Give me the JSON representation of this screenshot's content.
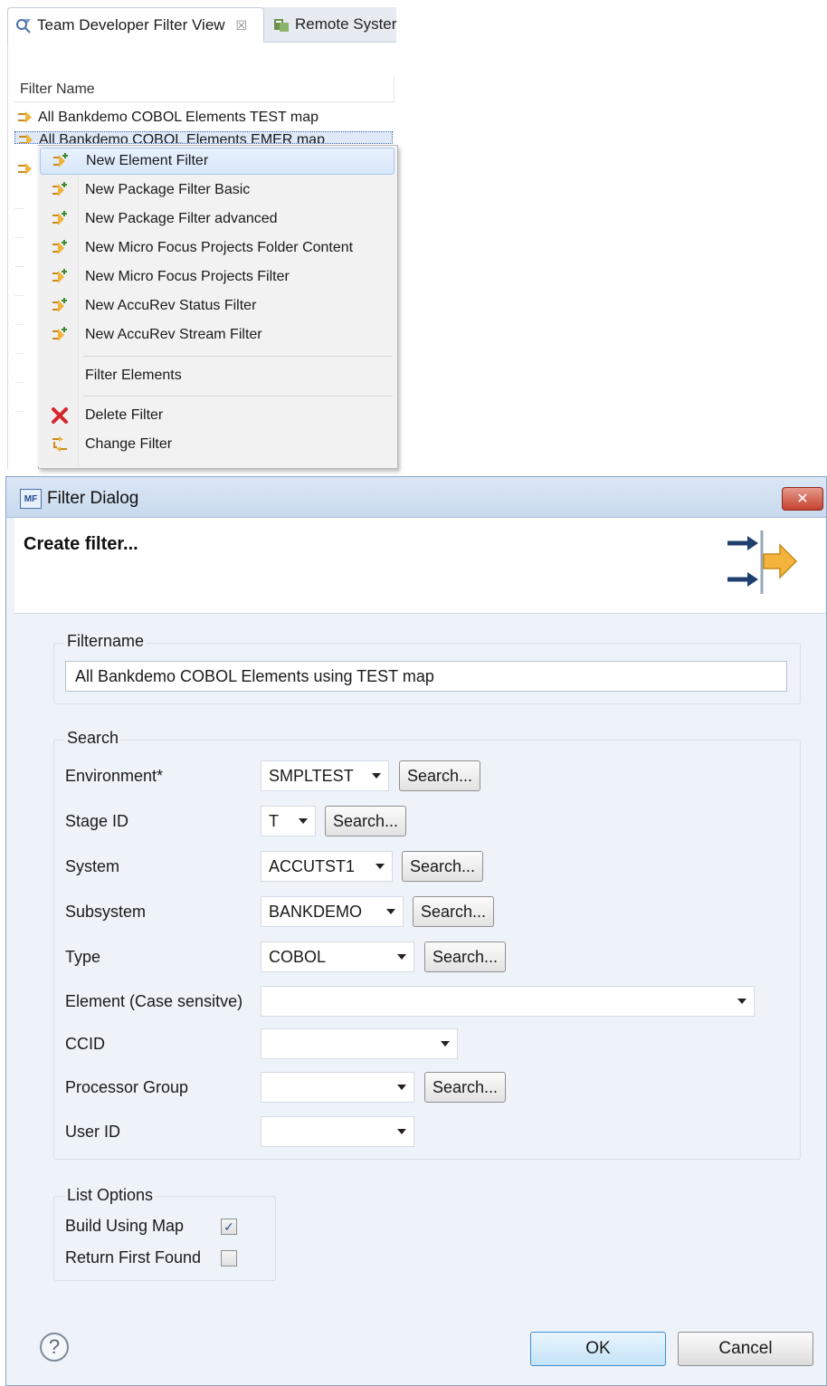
{
  "view": {
    "tabs": [
      {
        "label": "Team Developer Filter View",
        "close": "☒"
      },
      {
        "label": "Remote Syster"
      }
    ],
    "column_header": "Filter Name",
    "rows": [
      {
        "label": "All Bankdemo COBOL Elements TEST map"
      },
      {
        "label": "All Bankdemo COBOL Elements EMER map"
      },
      {
        "label": ""
      }
    ]
  },
  "context_menu": {
    "items": [
      {
        "label": "New Element Filter",
        "icon": "filter-add-icon"
      },
      {
        "label": "New Package Filter Basic",
        "icon": "filter-add-icon"
      },
      {
        "label": "New Package Filter advanced",
        "icon": "filter-add-icon"
      },
      {
        "label": "New Micro Focus Projects Folder Content",
        "icon": "filter-add-icon"
      },
      {
        "label": "New Micro Focus Projects Filter",
        "icon": "filter-add-icon"
      },
      {
        "label": "New AccuRev Status Filter",
        "icon": "filter-add-icon"
      },
      {
        "label": "New AccuRev Stream Filter",
        "icon": "filter-add-icon"
      },
      {
        "label": "Filter Elements",
        "icon": ""
      },
      {
        "label": "Delete Filter",
        "icon": "delete-icon"
      },
      {
        "label": "Change Filter",
        "icon": "change-icon"
      }
    ]
  },
  "dialog": {
    "title": "Filter Dialog",
    "title_icon": "MF",
    "close": "✕",
    "banner_title": "Create filter...",
    "filtername": {
      "group_label": "Filtername",
      "value": "All Bankdemo COBOL Elements using TEST map"
    },
    "search": {
      "group_label": "Search",
      "button_label": "Search...",
      "fields": {
        "environment": {
          "label": "Environment*",
          "value": "SMPLTEST"
        },
        "stage_id": {
          "label": "Stage ID",
          "value": "T"
        },
        "system": {
          "label": "System",
          "value": "ACCUTST1"
        },
        "subsystem": {
          "label": "Subsystem",
          "value": "BANKDEMO"
        },
        "type": {
          "label": "Type",
          "value": "COBOL"
        },
        "element": {
          "label": "Element (Case sensitve)",
          "value": ""
        },
        "ccid": {
          "label": "CCID",
          "value": ""
        },
        "processor_group": {
          "label": "Processor Group",
          "value": ""
        },
        "user_id": {
          "label": "User ID",
          "value": ""
        }
      }
    },
    "list_options": {
      "group_label": "List Options",
      "build_using_map": {
        "label": "Build Using Map",
        "checked": true,
        "mark": "✓"
      },
      "return_first_found": {
        "label": "Return First Found",
        "checked": false
      }
    },
    "help": "?",
    "ok_label": "OK",
    "cancel_label": "Cancel"
  }
}
